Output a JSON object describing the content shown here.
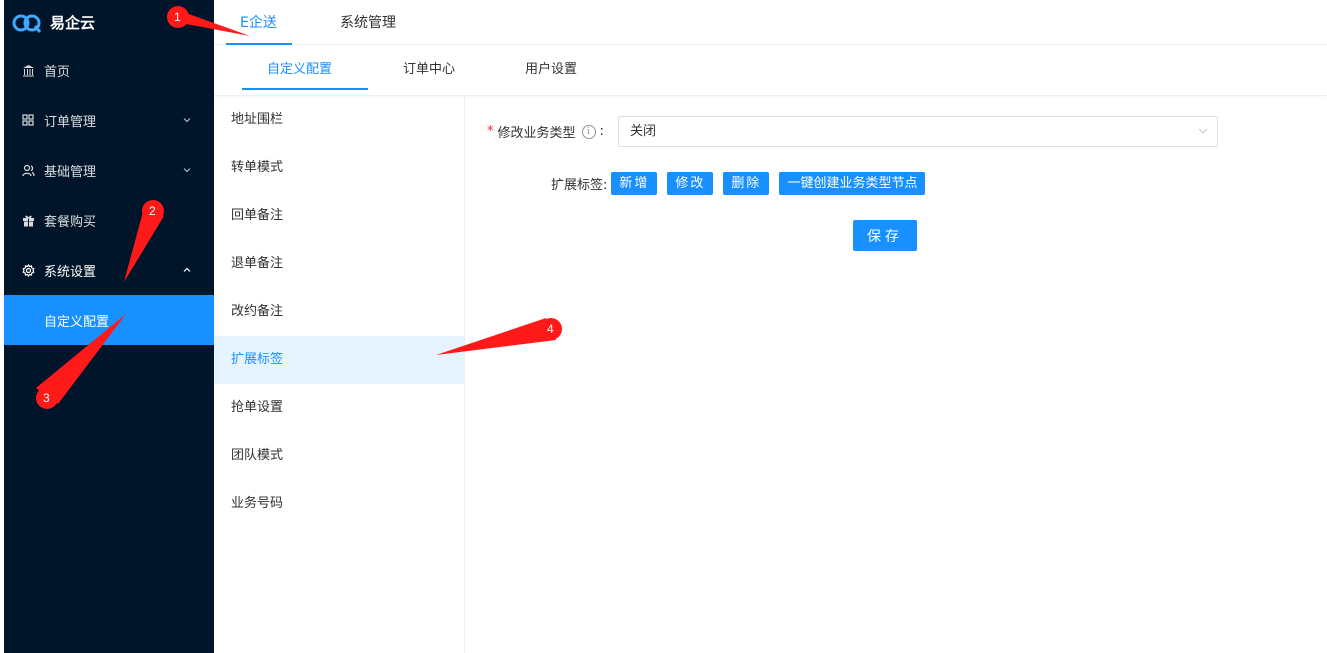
{
  "app": {
    "name": "易企云"
  },
  "sidebar": {
    "items": [
      {
        "label": "首页",
        "icon": "bank-icon"
      },
      {
        "label": "订单管理",
        "icon": "grid-icon"
      },
      {
        "label": "基础管理",
        "icon": "users-icon"
      },
      {
        "label": "套餐购买",
        "icon": "gift-icon"
      },
      {
        "label": "系统设置",
        "icon": "gear-icon"
      }
    ],
    "submenu": {
      "label": "自定义配置"
    }
  },
  "topnav": {
    "tabs": [
      {
        "label": "E企送"
      },
      {
        "label": "系统管理"
      }
    ],
    "active": 0
  },
  "subtabs": {
    "tabs": [
      {
        "label": "自定义配置"
      },
      {
        "label": "订单中心"
      },
      {
        "label": "用户设置"
      }
    ],
    "active": 0
  },
  "config_list": {
    "items": [
      "地址围栏",
      "转单模式",
      "回单备注",
      "退单备注",
      "改约备注",
      "扩展标签",
      "抢单设置",
      "团队模式",
      "业务号码"
    ],
    "active": 5
  },
  "form": {
    "business_type": {
      "label": "修改业务类型",
      "value": "关闭"
    },
    "tags": {
      "label": "扩展标签:",
      "buttons": {
        "add": "新增",
        "edit": "修改",
        "delete": "删除",
        "create": "一键创建业务类型节点"
      }
    },
    "save_label": "保存"
  },
  "annotations": [
    "1",
    "2",
    "3",
    "4"
  ],
  "colors": {
    "sidebar_bg": "#001529",
    "accent": "#1890ff",
    "annotation": "#ff1a1a"
  }
}
